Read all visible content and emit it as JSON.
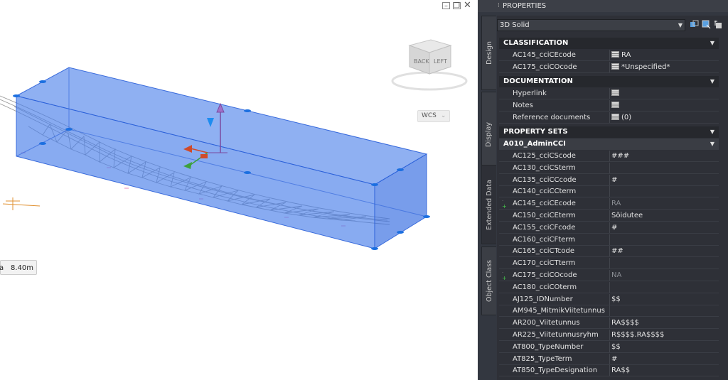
{
  "viewport": {
    "viewcube": {
      "back_label": "BACK",
      "left_label": "LEFT"
    },
    "wcs_label": "WCS",
    "dim_tooltip": {
      "prefix": "a",
      "value": "8.40m"
    },
    "colors": {
      "box_fill": "#4a7fe8",
      "box_edge": "#2558d8",
      "axis_z": "#7a4aa0",
      "axis_y": "#3da13d",
      "axis_x": "#d04a2a"
    }
  },
  "panel": {
    "title": "PROPERTIES",
    "selector": {
      "value": "3D Solid"
    },
    "tabs": [
      "Design",
      "Display",
      "Extended Data",
      "Object Class"
    ],
    "active_tab": "Extended Data",
    "classification": {
      "header": "CLASSIFICATION",
      "rows": [
        {
          "label": "AC145_cciCEcode",
          "value": "RA"
        },
        {
          "label": "AC175_cciCOcode",
          "value": "*Unspecified*"
        }
      ]
    },
    "documentation": {
      "header": "DOCUMENTATION",
      "rows": [
        {
          "label": "Hyperlink",
          "value": ""
        },
        {
          "label": "Notes",
          "value": ""
        },
        {
          "label": "Reference documents",
          "value": "(0)"
        }
      ]
    },
    "property_sets": {
      "header": "PROPERTY SETS",
      "set_name": "A010_AdminCCI",
      "rows": [
        {
          "label": "AC125_cciCScode",
          "value": "###"
        },
        {
          "label": "AC130_cciCSterm",
          "value": ""
        },
        {
          "label": "AC135_cciCCcode",
          "value": "#"
        },
        {
          "label": "AC140_cciCCterm",
          "value": ""
        },
        {
          "label": "AC145_cciCEcode",
          "value": "RA"
        },
        {
          "label": "AC150_cciCEterm",
          "value": "Sõidutee"
        },
        {
          "label": "AC155_cciCFcode",
          "value": "#"
        },
        {
          "label": "AC160_cciCFterm",
          "value": ""
        },
        {
          "label": "AC165_cciCTcode",
          "value": "##"
        },
        {
          "label": "AC170_cciCTterm",
          "value": ""
        },
        {
          "label": "AC175_cciCOcode",
          "value": "NA"
        },
        {
          "label": "AC180_cciCOterm",
          "value": ""
        },
        {
          "label": "AJ125_IDNumber",
          "value": "$$"
        },
        {
          "label": "AM945_MitmikViitetunnus",
          "value": ""
        },
        {
          "label": "AR200_Viitetunnus",
          "value": "RA$$$$"
        },
        {
          "label": "AR225_Viitetunnusryhm",
          "value": "R$$$$.RA$$$$"
        },
        {
          "label": "AT800_TypeNumber",
          "value": "$$"
        },
        {
          "label": "AT825_TypeTerm",
          "value": "#"
        },
        {
          "label": "AT850_TypeDesignation",
          "value": "RA$$"
        }
      ]
    }
  }
}
